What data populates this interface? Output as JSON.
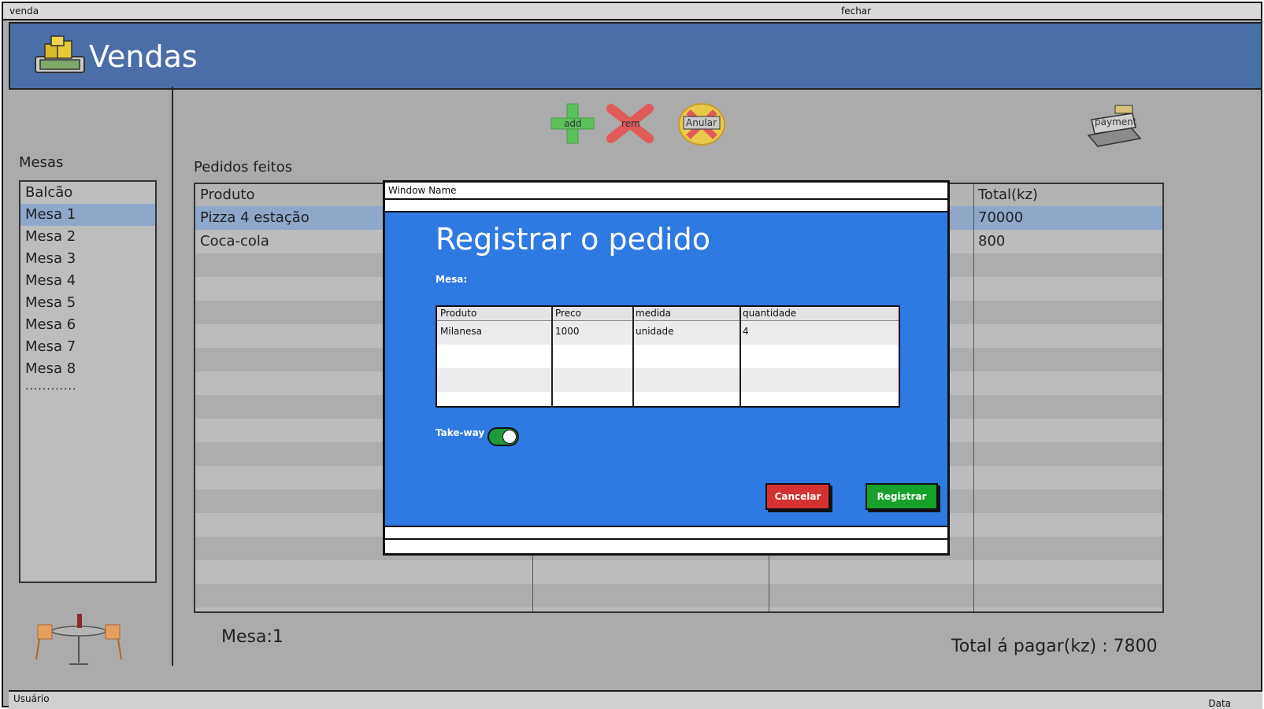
{
  "window": {
    "title": "venda",
    "close_label": "fechar"
  },
  "header": {
    "app_title": "Vendas"
  },
  "toolbar": {
    "add_label": "add",
    "rem_label": "rem",
    "anular_label": "Anular",
    "payment_label": "payment"
  },
  "sidebar": {
    "label": "Mesas",
    "items": [
      "Balcão",
      "Mesa 1",
      "Mesa 2",
      "Mesa 3",
      "Mesa 4",
      "Mesa 5",
      "Mesa 6",
      "Mesa 7",
      "Mesa 8"
    ],
    "selected_index": 1,
    "more": "............"
  },
  "orders": {
    "label": "Pedidos feitos",
    "columns": [
      "Produto",
      "Total(kz)"
    ],
    "rows": [
      {
        "produto": "Pizza 4 estação",
        "total": "70000"
      },
      {
        "produto": "Coca-cola",
        "total": "800"
      }
    ]
  },
  "footer": {
    "mesa": "Mesa:1",
    "total": "Total á pagar(kz) : 7800"
  },
  "statusbar": {
    "user": "Usuário",
    "date": "Data"
  },
  "modal": {
    "window_name": "Window Name",
    "heading": "Registrar o pedido",
    "mesa_label": "Mesa:",
    "columns": [
      "Produto",
      "Preco",
      "medida",
      "quantidade"
    ],
    "rows": [
      {
        "produto": "Milanesa",
        "preco": "1000",
        "medida": "unidade",
        "quantidade": "4"
      }
    ],
    "takeaway_label": "Take-way",
    "takeaway_on": true,
    "cancel_label": "Cancelar",
    "register_label": "Registrar"
  },
  "colors": {
    "header": "#4a6fa8",
    "modal_body": "#2f79e3",
    "selected_row": "#8fa7c9",
    "cancel": "#d63131",
    "register": "#17a02a"
  }
}
